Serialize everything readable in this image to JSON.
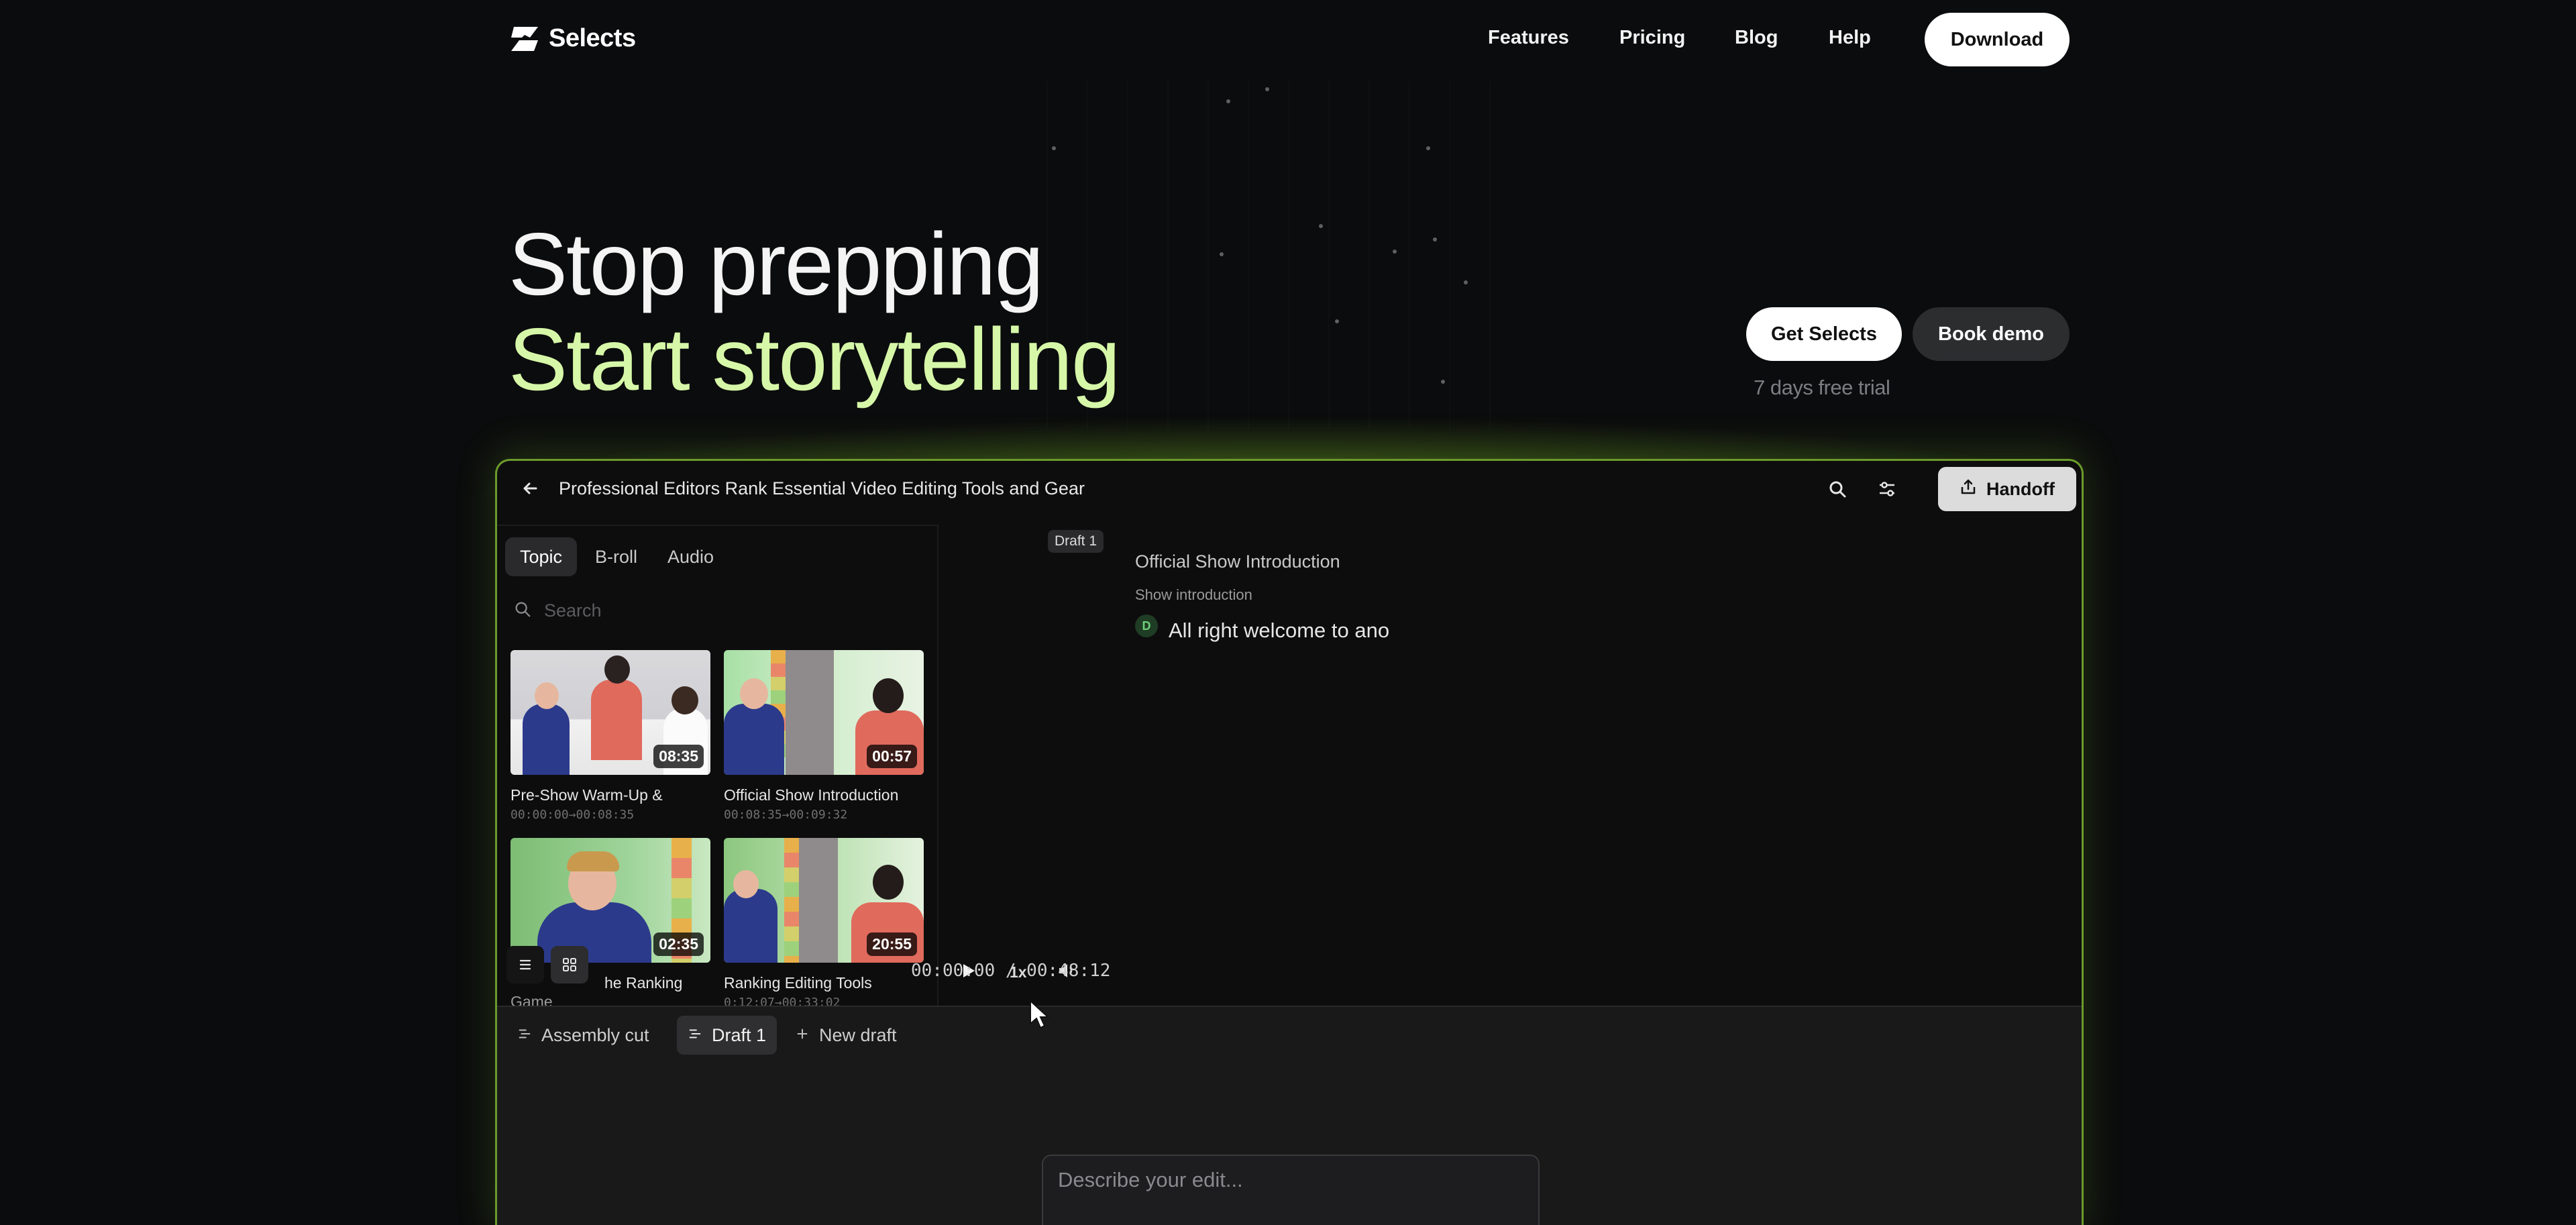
{
  "brand": {
    "name": "Selects"
  },
  "nav": {
    "links": [
      "Features",
      "Pricing",
      "Blog",
      "Help"
    ],
    "download_label": "Download"
  },
  "hero": {
    "line1": "Stop prepping",
    "line2": "Start storytelling",
    "get_label": "Get Selects",
    "demo_label": "Book demo",
    "trial_text": "7 days free trial"
  },
  "app": {
    "project_title": "Professional Editors Rank Essential Video Editing Tools and Gear",
    "handoff_label": "Handoff",
    "tabs": [
      "Topic",
      "B-roll",
      "Audio"
    ],
    "search_placeholder": "Search",
    "clips": [
      {
        "title": "Pre-Show Warm-Up &",
        "time": "00:00:00→00:08:35",
        "duration": "08:35"
      },
      {
        "title": "Official Show Introduction",
        "time": "00:08:35→00:09:32",
        "duration": "00:57"
      },
      {
        "title": "he Ranking",
        "title_wrap": "Game",
        "time": "",
        "duration": "02:35"
      },
      {
        "title": "Ranking Editing Tools",
        "time": "0:12:07→00:33:02",
        "duration": "20:55"
      }
    ],
    "draft_badge": "Draft 1",
    "transcript": {
      "heading": "Official Show Introduction",
      "subheading": "Show introduction",
      "speaker": "D",
      "line": "All right welcome to ano"
    },
    "player": {
      "speed": "1x",
      "timecode": "00:00:00 / 00:48:12"
    },
    "drafts": {
      "assembly_label": "Assembly cut",
      "draft1_label": "Draft 1",
      "new_label": "New draft"
    },
    "prompt_placeholder": "Describe your edit..."
  },
  "colors": {
    "accent_green": "#d6f7a8",
    "frame_border": "#6c9a2b",
    "background": "#0b0c0d"
  }
}
